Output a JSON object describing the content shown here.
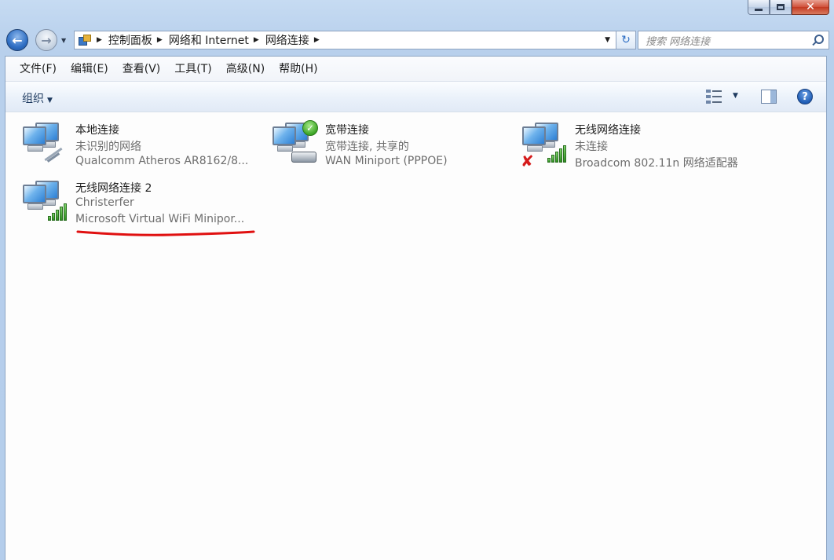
{
  "address": {
    "breadcrumbs": [
      "控制面板",
      "网络和 Internet",
      "网络连接"
    ]
  },
  "search": {
    "placeholder": "搜索 网络连接"
  },
  "menu": [
    "文件(F)",
    "编辑(E)",
    "查看(V)",
    "工具(T)",
    "高级(N)",
    "帮助(H)"
  ],
  "toolbar": {
    "organize_label": "组织"
  },
  "connections": [
    {
      "name": "本地连接",
      "status": "未识别的网络",
      "device": "Qualcomm Atheros AR8162/8...",
      "icon": "wired-network-icon"
    },
    {
      "name": "宽带连接",
      "status": "宽带连接, 共享的",
      "device": "WAN Miniport (PPPOE)",
      "icon": "broadband-connected-icon"
    },
    {
      "name": "无线网络连接",
      "status": "未连接",
      "device": "Broadcom 802.11n 网络适配器",
      "icon": "wireless-disconnected-icon"
    },
    {
      "name": "无线网络连接 2",
      "status": "Christerfer",
      "device": "Microsoft Virtual WiFi Minipor...",
      "icon": "wireless-connected-icon"
    }
  ],
  "colors": {
    "annotation_underline": "#e01010",
    "window_frame": "#b8d0ec"
  }
}
